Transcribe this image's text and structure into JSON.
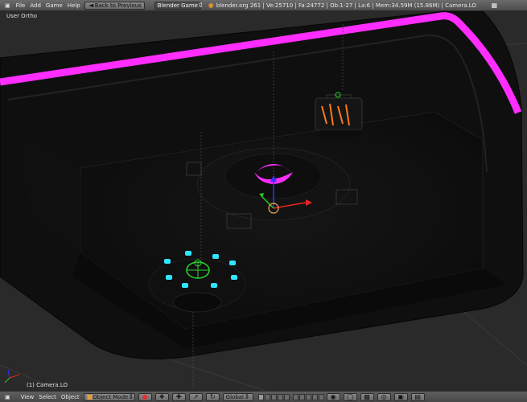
{
  "menu": {
    "file": "File",
    "add": "Add",
    "game": "Game",
    "help": "Help"
  },
  "back_button": "Back to Previous",
  "engine": "Blender Game",
  "stats": "blender.org 261 | Ve:25710 | Fa:24772 | Ob:1-27 | La:6 | Mem:34.59M (15.86M) | Camera.LO",
  "viewport": {
    "view_name": "User Ortho",
    "active_object": "(1) Camera.LO"
  },
  "bottom": {
    "view": "View",
    "select": "Select",
    "object": "Object",
    "mode": "Object Mode",
    "orientation": "Global"
  },
  "colors": {
    "magenta": "#ff2dff",
    "cyan": "#2ee6ff",
    "green": "#2bd82b",
    "grid": "#4a4a4a"
  }
}
